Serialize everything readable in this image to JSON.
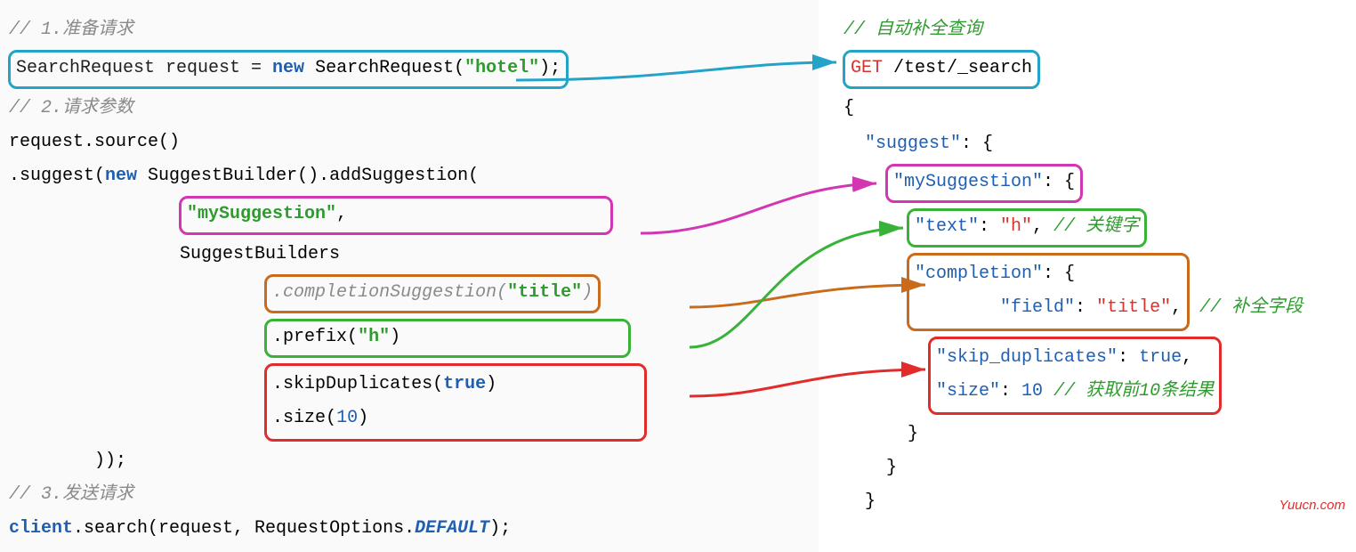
{
  "left": {
    "c1": "// 1.准备请求",
    "l2_pre": "SearchRequest request = ",
    "l2_new": "new",
    "l2_mid": " SearchRequest(",
    "l2_arg": "\"hotel\"",
    "l2_post": ");",
    "c3": "// 2.请求参数",
    "l4": "request.source()",
    "l5_pre": "        .suggest(",
    "l5_new": "new",
    "l5_post": " SuggestBuilder().addSuggestion(",
    "l6_pre": "                ",
    "l6_arg": "\"mySuggestion\"",
    "l6_post": ",",
    "l7": "                SuggestBuilders",
    "l8_pre": "                        ",
    "l8_call": ".completionSuggestion(",
    "l8_arg": "\"title\"",
    "l8_close": ")",
    "l9_pre": "                        ",
    "l9_call": ".prefix(",
    "l9_arg": "\"h\"",
    "l9_close": ")",
    "l10_pre": "                        ",
    "l10a": ".skipDuplicates(",
    "l10b": "true",
    "l10c": ")",
    "l11a": ".size(",
    "l11b": "10",
    "l11c": ")",
    "l12": "        ));",
    "c13": "// 3.发送请求",
    "l14_client": "client",
    "l14_mid": ".search(request, RequestOptions.",
    "l14_def": "DEFAULT",
    "l14_end": ");"
  },
  "right": {
    "c1": "// 自动补全查询",
    "l2_get": "GET",
    "l2_path": " /test/_search",
    "l3": "{",
    "l4_pre": "  ",
    "l4_key": "\"suggest\"",
    "l4_post": ": {",
    "l5_pre": "    ",
    "l5_key": "\"mySuggestion\"",
    "l5_post": ": {",
    "l6_pre": "      ",
    "l6_key": "\"text\"",
    "l6_mid": ": ",
    "l6_val": "\"h\"",
    "l6_post": ", ",
    "l6_cmt": "// 关键字",
    "l7_pre": "      ",
    "l7_key": "\"completion\"",
    "l7_post": ": {",
    "l8_pre": "        ",
    "l8_key": "\"field\"",
    "l8_mid": ": ",
    "l8_val": "\"title\"",
    "l8_post": ",",
    "l8_cmt": " // 补全字段",
    "l9_pre": "        ",
    "l9_key": "\"skip_duplicates\"",
    "l9_mid": ": ",
    "l9_val": "true",
    "l9_post": ",",
    "l10_key": "\"size\"",
    "l10_mid": ": ",
    "l10_val": "10",
    "l10_cmt": " // 获取前10条结果",
    "l11": "      }",
    "l12": "    }",
    "l13": "  }"
  },
  "watermark": "Yuucn.com"
}
